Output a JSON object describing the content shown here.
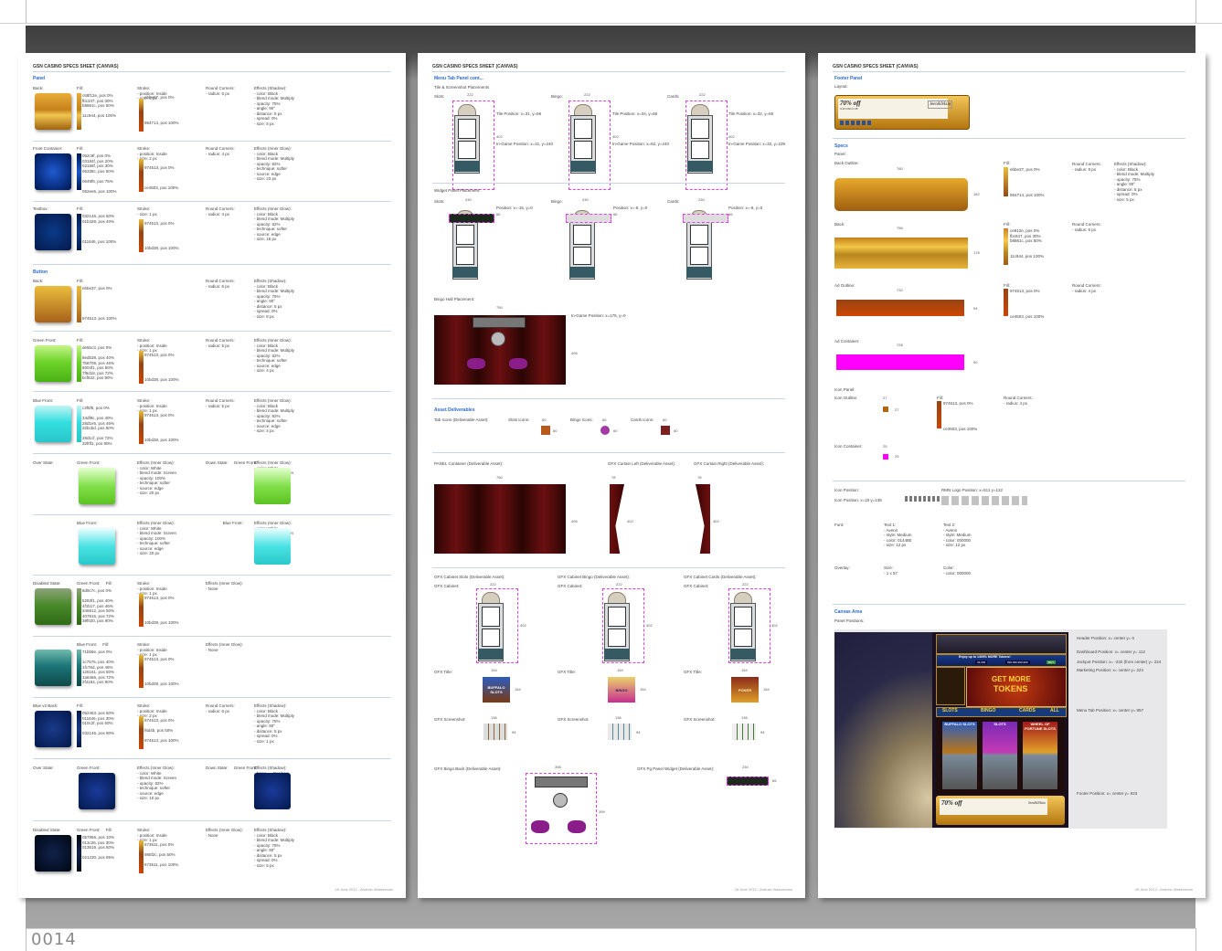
{
  "page": {
    "number": "0014"
  },
  "sheets": [
    {
      "title": "GSN CASINO SPECS SHEET (CANVAS)",
      "footer": "28 June 2012 - Andrew Wasserman"
    },
    {
      "title": "GSN CASINO SPECS SHEET (CANVAS)",
      "footer": "28 June 2012 - Andrew Wasserman"
    },
    {
      "title": "GSN CASINO SPECS SHEET (CANVAS)",
      "footer": "28 June 2012 - Andrew Wasserman"
    }
  ],
  "sheet1": {
    "panel_heading": "Panel",
    "button_heading": "Button",
    "rows": [
      {
        "label": "Back:",
        "fill_label": "Fill:",
        "fill_stops": "c68f12e, pos 0%\nfbc347, pos 30%\nb8861c, pos 50%\n\n11c944, pos 100%",
        "stroke": "Stroke:\n- position: Inside\n- size: 2 px",
        "stroke_stops": "ebbe07, pos 0%\n\n\n\n\n954714, pos 100%",
        "corners": "Round Corners:\n- radius: 6 px",
        "effects": "Effects (Shadow):\n- color: Black\n- blend mode: Multiply\n- opacity: 75%\n- angle: 90°\n- distance: 5 px\n- spread: 0%\n- size: 5 px"
      },
      {
        "label": "Front Container:",
        "fill_label": "Fill:",
        "fill_stops": "052c9f, pos 0%\n03184f, pos 20%\n02158f, pos 30%\n06338c, pos 50%\n\n0649f6, pos 75%\n\n052ee5, pos 100%",
        "stroke": "Stroke:\n- position: Inside\n- size: 2 px",
        "stroke_stops": "\n\n974513, pos 0%\n\n\n\nce4503, pos 100%",
        "corners": "Round Corners:\n- radius: 4 px",
        "effects": "Effects (Inner Glow):\n- color: Black\n- blend mode: Multiply\n- opacity: 82%\n- technique: softer\n- source: edge\n- size: 23 px"
      },
      {
        "label": "Textbox:",
        "fill_label": "Fill:",
        "fill_stops": "032146, pos 50%\n01b428, pos 40%\n\n\n\n011646, pos 100%",
        "stroke": "Stroke:\n- size: 1 px",
        "stroke_stops": "\n974513, pos 0%\n\n\n\n\n10bd38, pos 100%",
        "corners": "Round Corners:\n- radius: 4 px",
        "effects": "Effects (Inner Glow):\n- color: Black\n- blend mode: Multiply\n- opacity: 82%\n- technique: softer\n- source: edge\n- size: 16 px"
      },
      {
        "label": "Back:",
        "fill_label": "Fill:",
        "fill_stops": "ebbe37, pos 0%\n\n\n\n\n\n974513, pos 100%",
        "stroke": "",
        "stroke_stops": "",
        "corners": "Round Corners:\n- radius: 6 px",
        "effects": "Effects (Shadow):\n- color: Black\n- blend mode: Multiply\n- opacity: 75%\n- angle: 90°\n- distance: 5 px\n- spread: 0%\n- size: 8 px"
      },
      {
        "label": "Green Front:",
        "fill_label": "Fill:",
        "fill_stops": "de5bc3, pos 0%\n\n8edb38, pos 40%\n7b6708, pos 46%\n8004f1, pos 50%\n7f6d18, pos 72%\nbcf832, pos 90%",
        "stroke": "Stroke:\n- position: Inside\n- size: 1 px",
        "stroke_stops": "\n974513, pos 0%\n\n\n\n\n10bd38, pos 100%",
        "corners": "Round Corners:\n- radius: 5 px",
        "effects": "Effects (Inner Glow):\n- color: Black\n- blend mode: Multiply\n- opacity: 82%\n- technique: softer\n- source: edge\n- size: 4 px"
      },
      {
        "label": "Blue Front:",
        "fill_label": "Fill:",
        "fill_stops": "c3f5f5, pos 0%\n\n34df9c, pos 40%\n28d1e5, pos 46%\n32bcbd, pos 50%\n\n28d1cf, pos 72%\n32f0f1, pos 90%",
        "stroke": "Stroke:\n- position: Inside\n- size: 1 px",
        "stroke_stops": "\n974513, pos 0%\n\n\n\n\n10bd38, pos 100%",
        "corners": "Round Corners:\n- radius: 5 px",
        "effects": "Effects (Inner Glow):\n- color: Black\n- blend mode: Multiply\n- opacity: 82%\n- technique: softer\n- source: edge\n- size: 4 px"
      },
      {
        "label": "Over State:",
        "fill_label": "Green Front:",
        "fill_stops": "",
        "stroke": "Effects (Inner Glow):\n- color: White\n- blend mode: Screen\n- opacity: 100%\n- technique: softer\n- source: edge\n- size: 20 px",
        "stroke_stops": "",
        "corners": "Down State:     Green Front:",
        "effects": "Effects (Inner Glow):\n- color: White\n- blend mode: Screen\n- opacity: 82%\n- technique: softer\n- source: edge\n- size: 10 px"
      },
      {
        "label": "",
        "fill_label": "Blue Front:",
        "fill_stops": "",
        "stroke": "Effects (Inner Glow):\n- color: White\n- blend mode: Screen\n- opacity: 100%\n- technique: softer\n- source: edge\n- size: 20 px",
        "stroke_stops": "",
        "corners": "               Blue Front:",
        "effects": "Effects (Inner Glow):\n- color: White\n- blend mode: Screen\n- opacity: 82%\n- technique: softer\n- source: edge\n- size: 10 px"
      },
      {
        "label": "Disabled State:",
        "fill_label": "Green Front:     Fill:",
        "fill_stops": "8d9c7c, pos 0%\n\n5283f1, pos 40%\n4f1b17, pos 46%\n346912, pos 50%\n407816, pos 72%\n39f020, pos 90%",
        "stroke": "Stroke:\n- position: Inside\n- size: 1 px",
        "stroke_stops": "\n974513, pos 0%\n\n\n\n\n10bd39, pos 100%",
        "corners": "Effects (Inner Glow):\n- None",
        "effects": ""
      },
      {
        "label": "",
        "fill_label": "Blue Front:     Fill:",
        "fill_stops": "71bb8e, pos 0%\n\n1c7576, pos 40%\n1fc76d, pos 46%\n126161, pos 50%\n1a6466, pos 72%\n2f4184, pos 90%",
        "stroke": "Stroke:\n- position: Inside\n- size: 1 px",
        "stroke_stops": "\n974513, pos 0%\n\n\n\n\n10bd39, pos 100%",
        "corners": "Effects (Inner Glow):\n- None",
        "effects": ""
      },
      {
        "label": "Blue v2 Back:",
        "fill_label": "Fill:",
        "fill_stops": "052463, pos 50%\n011646, pos 30%\n010c2f, pos 60%\n\n032146, pos 90%",
        "stroke": "Stroke:\n- position: Inside\n- size: 2 px",
        "stroke_stops": "\n974513, pos 0%\n\nf6d4b, pos 50%\n\n974513, pos 100%",
        "corners": "Round Corners:\n- radius: 6 px",
        "effects": "Effects (Shadow):\n- color: Black\n- blend mode: Multiply\n- opacity: 75%\n- angle: 90°\n- distance: 5 px\n- spread: 0%\n- size: 1 px"
      },
      {
        "label": "Over State:",
        "fill_label": "Green Front:",
        "fill_stops": "",
        "stroke": "Effects (Inner Glow):\n- color: White\n- blend mode: Screen\n- opacity: 82%\n- technique: softer\n- source: edge\n- size: 10 px",
        "stroke_stops": "",
        "corners": "Down State:     Green Front:",
        "effects": "Effects (Shadow):\n- None      Position:\n            - Down 4 px"
      },
      {
        "label": "Disabled State:",
        "fill_label": "Green Front:     Fill:",
        "fill_stops": "057956, pos 10%\n013c26, pos 30%\n013619, pos 60%\n\n021230, pos 95%",
        "stroke": "Stroke:\n- position: Inside\n- size: 1 px",
        "stroke_stops": "\n673511, pos 0%\n\n985f2c, pos 50%\n\n673511, pos 100%",
        "corners": "Effects (Inner Glow):\n- None",
        "effects": "Effects (Shadow):\n- color: Black\n- blend mode: Multiply\n- opacity: 78%\n- angle: 90°\n- distance: 5 px\n- spread: 0%\n- size: 5 px"
      }
    ]
  },
  "sheet2": {
    "menu_heading": "Menu Tab Panel cont...",
    "tile_heading": "Tile & Screenshot Placements",
    "slots_label": "Slots:",
    "bingo_label": "Bingo:",
    "cards_label": "Cards:",
    "w222": "222",
    "h402": "402",
    "tile_pos_slots": "Tile Position: x=31, y=66",
    "ingame_slots": "In-Game Position: x=31, y=240",
    "tile_pos_bingo": "Tile Position: x=34, y=66",
    "ingame_bingo": "In-Game Position: x=82, y=240",
    "tile_pos_cards": "Tile Position: x=32, y=66",
    "ingame_cards": "In-Game Position: x=32, y=239",
    "widget_heading": "Widget Panel Placement:",
    "w230": "230",
    "h66": "66",
    "widget_pos_slots": "Position: x=-15, y=0",
    "widget_pos_bingo": "Position: x=-8, y=0",
    "widget_pos_cards": "Position: x=-8, y=0",
    "bingo_hall_heading": "Bingo Hall Placement:",
    "w750": "750",
    "h406": "406",
    "bingo_hall_pos": "In-Game Position: x=175, y=0",
    "asset_heading": "Asset Deliverables",
    "tab_icons": "Tab Icons (Deliverable Asset):",
    "slots_icons": "Slots Icons:",
    "bingo_icons": "Bingo Icons:",
    "cards_icons": "Cards Icons:",
    "w60": "60",
    "h60": "60",
    "panel_container": "PANEL Container (Deliverable Asset):",
    "curtain_left": "GFX Curtain Left (Deliverable Asset):",
    "curtain_right": "GFX Curtain Right (Deliverable Asset):",
    "w78": "78",
    "h402b": "402",
    "h406b": "406",
    "cab_slots": "GFX Cabinet Slots (Deliverable Asset):",
    "cab_bingo": "GFX Cabinet Bingo (Deliverable Asset):",
    "cab_cards": "GFX Cabinet Cards (Deliverable Asset):",
    "gfx_cabinet": "GFX Cabinet:",
    "gfx_title": "GFX Title:",
    "gfx_screenshot": "GFX Screenshot:",
    "w154": "154",
    "h154": "154",
    "w136": "136",
    "h94": "94",
    "title_slots": "BUFFALO SLOTS",
    "title_bingo": "BINGO",
    "title_cards": "POKER",
    "bingo_back": "GFX Bingo Back (Deliverable Asset):",
    "w398": "398",
    "h399": "399",
    "pg_widget": "GFX Pg Panel Widget (Deliverable Asset):",
    "w230b": "230",
    "h65": "65"
  },
  "sheet3": {
    "footer_heading": "Footer Panel",
    "layout_label": "Layout:",
    "ad_text": "70% off",
    "ad_sub": "GSN RECLUB",
    "brand": "Jeen&Main",
    "specs_heading": "Specs",
    "panel_label": "Panel:",
    "back_outline": "Back Outline:",
    "w760": "760",
    "h182": "182",
    "fill_a": "ebbe37, pos 0%\n\n\n\n\n954714, pos 100%",
    "corners_a": "Round Corners:\n- radius: 8 px",
    "effects_a": "Effects (Shadow):\n- color: Black\n- blend mode: Multiply\n- opacity: 75%\n- angle: 90°\n- distance: 5 px\n- spread: 0%\n- size: 5 px",
    "back": "Back:",
    "w756": "756",
    "h178": "178",
    "fill_b": "ce812e, pos 0%\nfbc847, pos 30%\nb8861c, pos 50%\n\n\n11c944, pos 100%",
    "corners_b": "Round Corners:\n- radius: 6 px",
    "ad_outline": "Ad Outline:",
    "w732": "732",
    "h94": "94",
    "fill_c": "974513, pos 0%\n\n\n\n\nce4503, pos 100%",
    "corners_c": "Round Corners:\n- radius: 4 px",
    "ad_container": "Ad Container:",
    "w728": "728",
    "h90": "90",
    "icon_panel": "Icon Panel:",
    "icon_outline": "Icon Outline:",
    "w27": "27",
    "h27": "27",
    "fill_d": "974513, pos 0%\n\n\n\n\nce4503, pos 100%",
    "corners_d": "Round Corners:\n- radius: 4 px",
    "icon_container": "Icon Container:",
    "w25": "25",
    "h25": "25",
    "icon_position": "Icon Position:",
    "icon_position_val": "Icon Position: x=19 y=138",
    "logo_position": "RMN Logo Position: x=511 y=122",
    "font_label": "Font:",
    "text1": "Text 1:\n- Avenir\n- style: Medium\n- color: 01448E\n- size: 12 px",
    "text2": "Text 2:\n- Avenir\n- style: Medium\n- color: 000000\n- size: 12 px",
    "overlay_label": "Overlay:",
    "overlay_size": "Size:\n- 1 x 57",
    "overlay_color": "Color:\n- color: 000000",
    "canvas_heading": "Canvas Area",
    "panel_positions": "Panel Positions:",
    "pos_header": "Header Position: x= center y= 0",
    "pos_dashboard": "Dashboard Position: x= center y= 112",
    "pos_jackpot": "Jackpot Position: x= -232 (from center) y= 224",
    "pos_marketing": "Marketing Position: x= center y= 224",
    "pos_menu": "Menu Tab Position: x= center y= 857",
    "pos_footer": "Footer Position: x= center y= 923",
    "game_banner": "Enjoy up to 1400% MORE Tokens!",
    "game_num1": "29,393",
    "game_num2": "999,999,999,999",
    "game_buy": "BUY",
    "game_get_more": "GET MORE",
    "game_tokens": "TOKENS",
    "tab_slots": "SLOTS",
    "tab_bingo": "BINGO",
    "tab_cards": "CARDS",
    "tab_all": "ALL",
    "game1": "BUFFALO SLOTS",
    "game2": "SLOTS",
    "game3": "WHEEL OF FORTUNE SLOTS",
    "game_offer": "70% off",
    "game_brand": "Jeen&Main"
  }
}
